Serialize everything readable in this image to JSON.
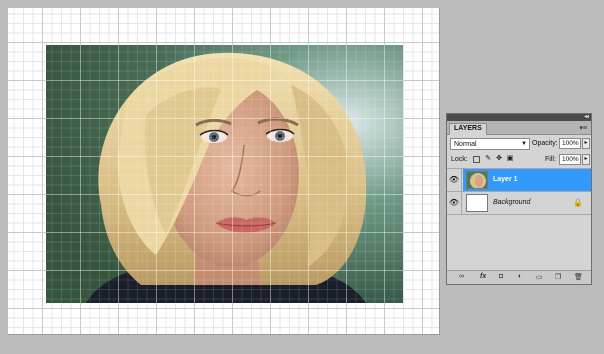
{
  "panel": {
    "collapse_glyph": "◂◂",
    "tab_label": "LAYERS",
    "menu_glyph": "▾≡",
    "blend_mode": "Normal",
    "opacity_label": "Opacity:",
    "opacity_value": "100%",
    "lock_label": "Lock:",
    "fill_label": "Fill:",
    "fill_value": "100%",
    "stepper_glyph": "▸"
  },
  "layers": [
    {
      "name": "Layer 1",
      "visible": true,
      "selected": true
    },
    {
      "name": "Background",
      "visible": true,
      "selected": false,
      "locked": true
    }
  ],
  "colors": {
    "selection": "#3399ff",
    "workspace": "#bcbcbc",
    "panel": "#d4d4d4"
  },
  "icons": {
    "eye": "eye-icon",
    "lock": "lock-icon",
    "footer": [
      "link-icon",
      "fx-icon",
      "mask-icon",
      "adjustment-icon",
      "group-folder-icon",
      "new-layer-icon",
      "trash-icon"
    ]
  }
}
